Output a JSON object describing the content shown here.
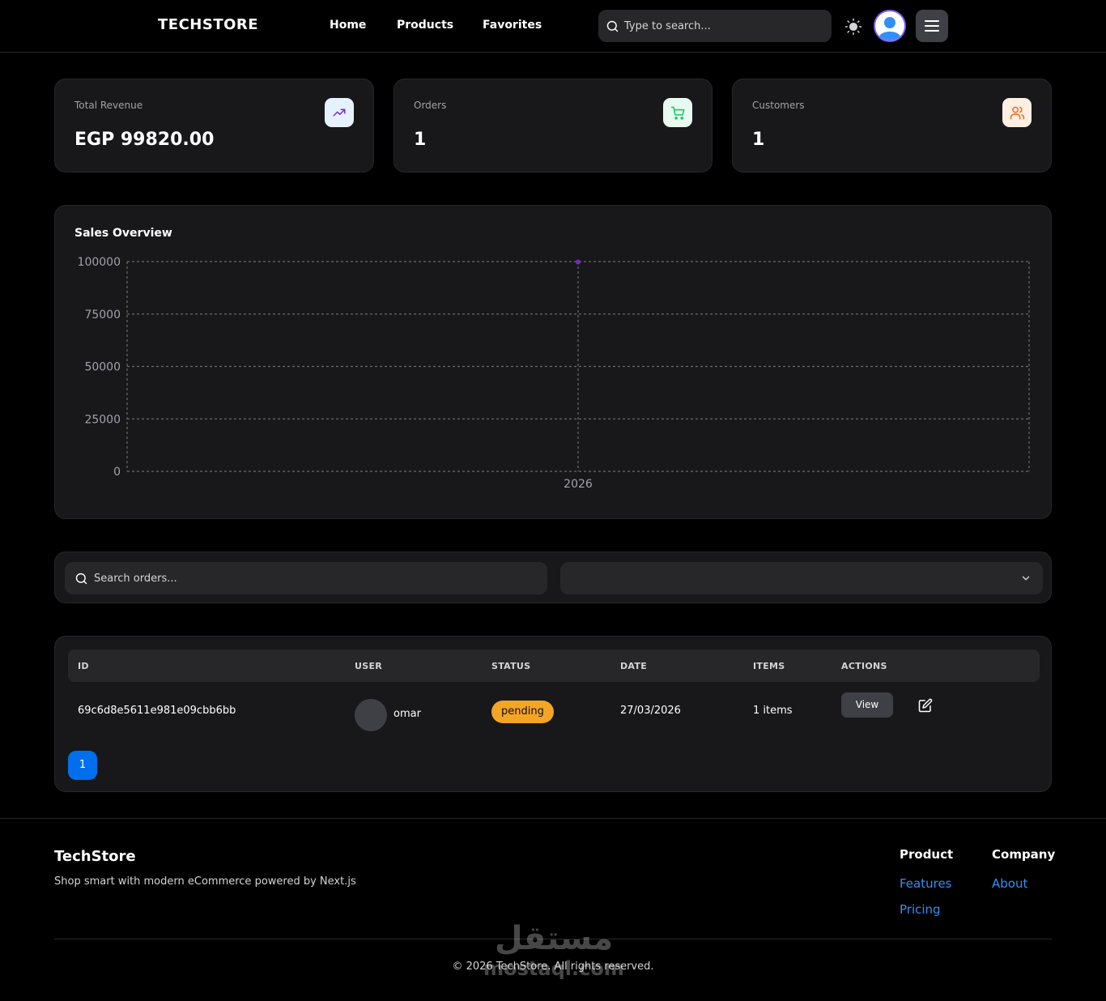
{
  "nav": {
    "brand": "TECHSTORE",
    "links": [
      "Home",
      "Products",
      "Favorites"
    ],
    "search_placeholder": "Type to search..."
  },
  "stats": [
    {
      "label": "Total Revenue",
      "value": "EGP 99820.00",
      "icon": "trending-up-icon",
      "icon_bg": "#e6f1fe",
      "icon_color": "#7828c8"
    },
    {
      "label": "Orders",
      "value": "1",
      "icon": "cart-icon",
      "icon_bg": "#e8faf0",
      "icon_color": "#17c964"
    },
    {
      "label": "Customers",
      "value": "1",
      "icon": "users-icon",
      "icon_bg": "#fefce8",
      "icon_color": "#f5a524"
    }
  ],
  "chart_title": "Sales Overview",
  "chart_data": {
    "type": "line",
    "x": [
      "2026"
    ],
    "series": [
      {
        "values": [
          99820
        ],
        "color": "#7828c8"
      }
    ],
    "ylim": [
      0,
      100000
    ],
    "yticks": [
      0,
      25000,
      50000,
      75000,
      100000
    ],
    "grid": true
  },
  "filters": {
    "search_placeholder": "Search orders...",
    "status_value": ""
  },
  "table": {
    "headers": [
      "ID",
      "USER",
      "STATUS",
      "DATE",
      "ITEMS",
      "ACTIONS"
    ],
    "rows": [
      {
        "id": "69c6d8e5611e981e09cbb6bb",
        "user": "omar",
        "status": "pending",
        "date": "27/03/2026",
        "items": "1 items",
        "action": "View"
      }
    ],
    "page": "1"
  },
  "footer": {
    "brand": "TechStore",
    "tagline": "Shop smart with modern eCommerce powered by Next.js",
    "product_heading": "Product",
    "product_links": [
      "Features",
      "Pricing"
    ],
    "company_heading": "Company",
    "company_links": [
      "About"
    ],
    "copyright": "© 2026 TechStore. All rights reserved.",
    "watermark": "مستقل mostaql.com"
  }
}
